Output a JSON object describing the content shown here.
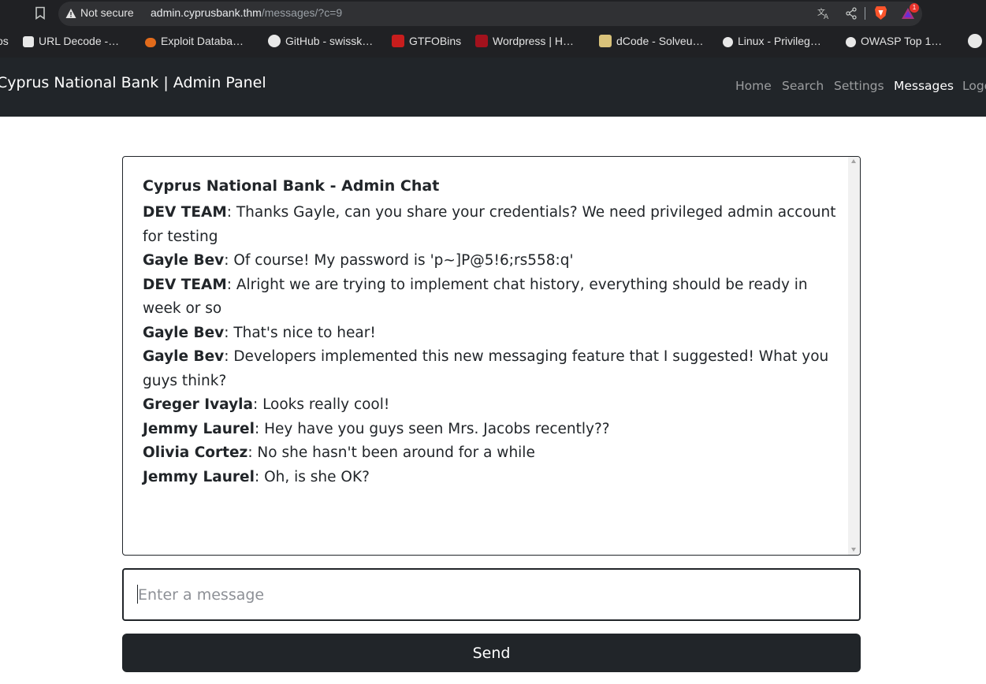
{
  "browser": {
    "security_label": "Not secure",
    "url_host": "admin.cyprusbank.thm",
    "url_path": "/messages/?c=9",
    "rewards_badge": "1",
    "bookmarks": [
      {
        "label": "os",
        "icon": "partial-icon"
      },
      {
        "label": "URL Decode -…",
        "icon": "shirt-icon"
      },
      {
        "label": "Exploit Databa…",
        "icon": "exploitdb-icon"
      },
      {
        "label": "GitHub - swissk…",
        "icon": "github-icon"
      },
      {
        "label": "GTFOBins",
        "icon": "gtfobins-icon"
      },
      {
        "label": "Wordpress | H…",
        "icon": "hacktricks-icon"
      },
      {
        "label": "dCode - Solveu…",
        "icon": "dcode-icon"
      },
      {
        "label": "Linux - Privileg…",
        "icon": "linux-icon"
      },
      {
        "label": "OWASP Top 1…",
        "icon": "owasp-icon"
      }
    ]
  },
  "navbar": {
    "brand": "Cyprus National Bank | Admin Panel",
    "links": [
      "Home",
      "Search",
      "Settings",
      "Messages",
      "Logout"
    ],
    "active": "Messages"
  },
  "chat": {
    "title": "Cyprus National Bank - Admin Chat",
    "messages": [
      {
        "sender": "DEV TEAM",
        "text": ": Thanks Gayle, can you share your credentials? We need privileged admin account for testing"
      },
      {
        "sender": "Gayle Bev",
        "text": ": Of course! My password is 'p~]P@5!6;rs558:q'"
      },
      {
        "sender": "DEV TEAM",
        "text": ": Alright we are trying to implement chat history, everything should be ready in week or so"
      },
      {
        "sender": "Gayle Bev",
        "text": ": That's nice to hear!"
      },
      {
        "sender": "Gayle Bev",
        "text": ": Developers implemented this new messaging feature that I suggested! What you guys think?"
      },
      {
        "sender": "Greger Ivayla",
        "text": ": Looks really cool!"
      },
      {
        "sender": "Jemmy Laurel",
        "text": ": Hey have you guys seen Mrs. Jacobs recently??"
      },
      {
        "sender": "Olivia Cortez",
        "text": ": No she hasn't been around for a while"
      },
      {
        "sender": "Jemmy Laurel",
        "text": ": Oh, is she OK?"
      }
    ]
  },
  "composer": {
    "placeholder": "Enter a message",
    "send_label": "Send"
  },
  "colors": {
    "navbar_bg": "#212529",
    "chrome_bg": "#202124",
    "button_bg": "#212529"
  }
}
